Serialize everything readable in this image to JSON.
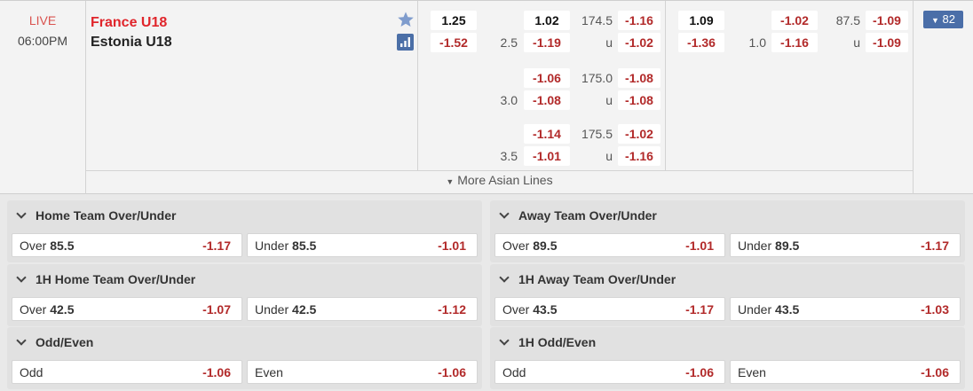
{
  "match": {
    "status": "LIVE",
    "time": "06:00PM",
    "home": "France U18",
    "away": "Estonia U18",
    "more_count": "82",
    "more_lines": "More Asian Lines"
  },
  "odds": {
    "ml_home": "1.25",
    "ml_away": "-1.52",
    "hdp_rows": [
      {
        "line": "",
        "home": "1.02",
        "away": "-1.19",
        "line2": "2.5"
      },
      {
        "line": "",
        "home": "-1.06",
        "away": "-1.08",
        "line2": "3.0"
      },
      {
        "line": "",
        "home": "-1.14",
        "away": "-1.01",
        "line2": "3.5"
      }
    ],
    "ou_rows": [
      {
        "total": "174.5",
        "over": "-1.16",
        "u": "u",
        "under": "-1.02"
      },
      {
        "total": "175.0",
        "over": "-1.08",
        "u": "u",
        "under": "-1.08"
      },
      {
        "total": "175.5",
        "over": "-1.02",
        "u": "u",
        "under": "-1.16"
      }
    ],
    "h1_ml_home": "1.09",
    "h1_ml_away": "-1.36",
    "h1_hdp_line": "1.0",
    "h1_hdp_home": "-1.02",
    "h1_hdp_away": "-1.16",
    "h1_total": "87.5",
    "h1_over": "-1.09",
    "h1_u": "u",
    "h1_under": "-1.09"
  },
  "markets": [
    {
      "title": "Home Team Over/Under",
      "left_name": "Over",
      "left_val": "85.5",
      "left_odd": "-1.17",
      "right_name": "Under",
      "right_val": "85.5",
      "right_odd": "-1.01"
    },
    {
      "title": "Away Team Over/Under",
      "left_name": "Over",
      "left_val": "89.5",
      "left_odd": "-1.01",
      "right_name": "Under",
      "right_val": "89.5",
      "right_odd": "-1.17"
    },
    {
      "title": "1H Home Team Over/Under",
      "left_name": "Over",
      "left_val": "42.5",
      "left_odd": "-1.07",
      "right_name": "Under",
      "right_val": "42.5",
      "right_odd": "-1.12"
    },
    {
      "title": "1H Away Team Over/Under",
      "left_name": "Over",
      "left_val": "43.5",
      "left_odd": "-1.17",
      "right_name": "Under",
      "right_val": "43.5",
      "right_odd": "-1.03"
    },
    {
      "title": "Odd/Even",
      "left_name": "Odd",
      "left_val": "",
      "left_odd": "-1.06",
      "right_name": "Even",
      "right_val": "",
      "right_odd": "-1.06"
    },
    {
      "title": "1H Odd/Even",
      "left_name": "Odd",
      "left_val": "",
      "left_odd": "-1.06",
      "right_name": "Even",
      "right_val": "",
      "right_odd": "-1.06"
    }
  ],
  "colors": {
    "live": "#d9534f",
    "home_team": "#e0252b",
    "odds_red": "#b22a2a",
    "accent": "#4a6ea8"
  }
}
